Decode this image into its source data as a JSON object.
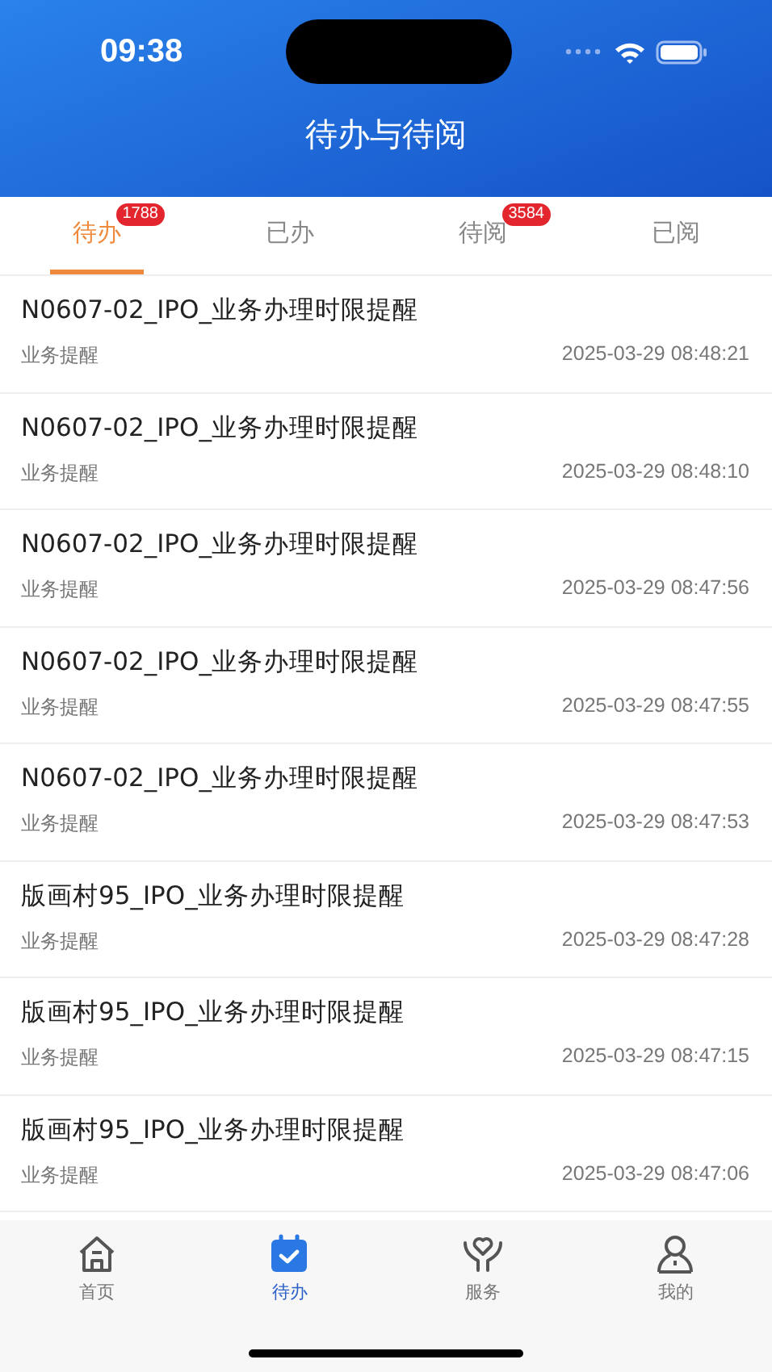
{
  "status_bar": {
    "time": "09:38"
  },
  "header": {
    "title": "待办与待阅"
  },
  "tabs": [
    {
      "label": "待办",
      "selected": true,
      "badge": "1788"
    },
    {
      "label": "已办",
      "selected": false
    },
    {
      "label": "待阅",
      "selected": false,
      "badge": "3584"
    },
    {
      "label": "已阅",
      "selected": false
    }
  ],
  "items": [
    {
      "title": "N0607-02_IPO_业务办理时限提醒",
      "category": "业务提醒",
      "time": "2025-03-29 08:48:21"
    },
    {
      "title": "N0607-02_IPO_业务办理时限提醒",
      "category": "业务提醒",
      "time": "2025-03-29 08:48:10"
    },
    {
      "title": "N0607-02_IPO_业务办理时限提醒",
      "category": "业务提醒",
      "time": "2025-03-29 08:47:56"
    },
    {
      "title": "N0607-02_IPO_业务办理时限提醒",
      "category": "业务提醒",
      "time": "2025-03-29 08:47:55"
    },
    {
      "title": "N0607-02_IPO_业务办理时限提醒",
      "category": "业务提醒",
      "time": "2025-03-29 08:47:53"
    },
    {
      "title": "版画村95_IPO_业务办理时限提醒",
      "category": "业务提醒",
      "time": "2025-03-29 08:47:28"
    },
    {
      "title": "版画村95_IPO_业务办理时限提醒",
      "category": "业务提醒",
      "time": "2025-03-29 08:47:15"
    },
    {
      "title": "版画村95_IPO_业务办理时限提醒",
      "category": "业务提醒",
      "time": "2025-03-29 08:47:06"
    }
  ],
  "bottom_nav": [
    {
      "label": "首页",
      "selected": false
    },
    {
      "label": "待办",
      "selected": true
    },
    {
      "label": "服务",
      "selected": false
    },
    {
      "label": "我的",
      "selected": false
    }
  ]
}
